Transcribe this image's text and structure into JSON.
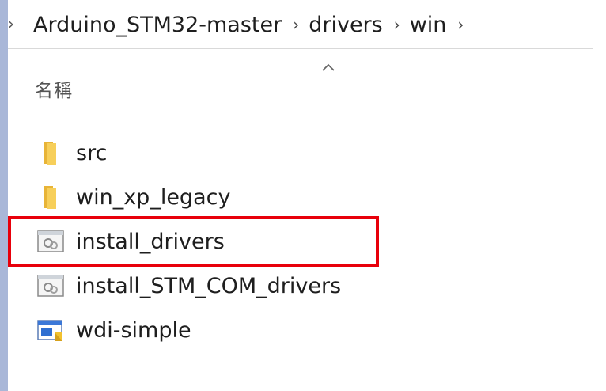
{
  "breadcrumb": {
    "items": [
      "Arduino_STM32-master",
      "drivers",
      "win"
    ]
  },
  "column_header": {
    "name_label": "名稱"
  },
  "files": [
    {
      "name": "src",
      "icon": "folder-icon"
    },
    {
      "name": "win_xp_legacy",
      "icon": "folder-icon"
    },
    {
      "name": "install_drivers",
      "icon": "batch-file-icon"
    },
    {
      "name": "install_STM_COM_drivers",
      "icon": "batch-file-icon"
    },
    {
      "name": "wdi-simple",
      "icon": "executable-icon"
    }
  ],
  "colors": {
    "highlight": "#e8000b",
    "folder": "#f4c542"
  }
}
